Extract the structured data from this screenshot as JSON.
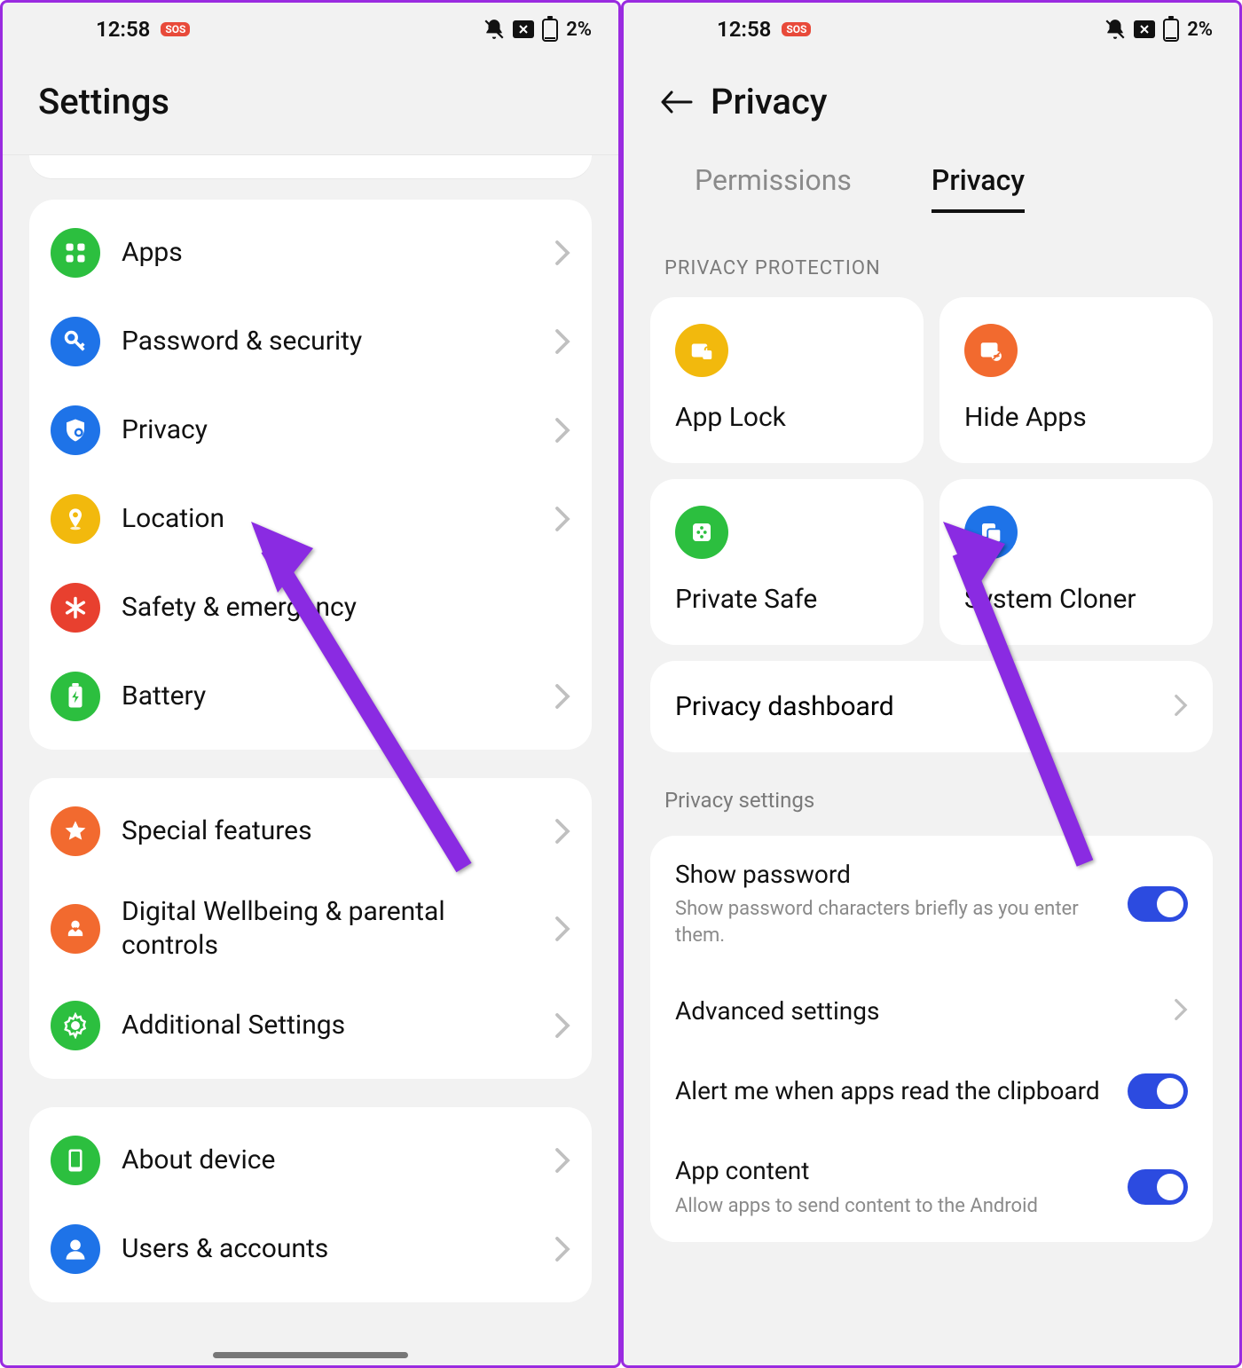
{
  "statusbar": {
    "time": "12:58",
    "battery": "2%",
    "sos": "SOS"
  },
  "left": {
    "title": "Settings",
    "group1": [
      {
        "label": "Apps",
        "icon": "apps",
        "color": "#2cbf3f"
      },
      {
        "label": "Password & security",
        "icon": "key",
        "color": "#1e73e8"
      },
      {
        "label": "Privacy",
        "icon": "shield",
        "color": "#1e73e8"
      },
      {
        "label": "Location",
        "icon": "pin",
        "color": "#f2b90d"
      },
      {
        "label": "Safety & emergency",
        "icon": "asterisk",
        "color": "#e8402f"
      },
      {
        "label": "Battery",
        "icon": "battery",
        "color": "#2cbf3f"
      }
    ],
    "group2": [
      {
        "label": "Special features",
        "icon": "star",
        "color": "#f26a2f"
      },
      {
        "label": "Digital Wellbeing & parental controls",
        "icon": "heart",
        "color": "#f26a2f"
      },
      {
        "label": "Additional Settings",
        "icon": "gear",
        "color": "#2cbf3f"
      }
    ],
    "group3": [
      {
        "label": "About device",
        "icon": "device",
        "color": "#2cbf3f"
      },
      {
        "label": "Users & accounts",
        "icon": "user",
        "color": "#1e73e8"
      }
    ]
  },
  "right": {
    "title": "Privacy",
    "tabs": {
      "permissions": "Permissions",
      "privacy": "Privacy"
    },
    "section_protection": "PRIVACY PROTECTION",
    "tiles": [
      {
        "label": "App Lock",
        "icon": "applock",
        "color": "#f2b90d"
      },
      {
        "label": "Hide Apps",
        "icon": "hide",
        "color": "#f26a2f"
      },
      {
        "label": "Private Safe",
        "icon": "safe",
        "color": "#2cbf3f"
      },
      {
        "label": "System Cloner",
        "icon": "clone",
        "color": "#1e73e8"
      }
    ],
    "dashboard": "Privacy dashboard",
    "section_settings": "Privacy settings",
    "settings": {
      "show_password": {
        "title": "Show password",
        "sub": "Show password characters briefly as you enter them."
      },
      "advanced": {
        "title": "Advanced settings"
      },
      "clipboard": {
        "title": "Alert me when apps read the clipboard"
      },
      "app_content": {
        "title": "App content",
        "sub": "Allow apps to send content to the Android"
      }
    }
  }
}
